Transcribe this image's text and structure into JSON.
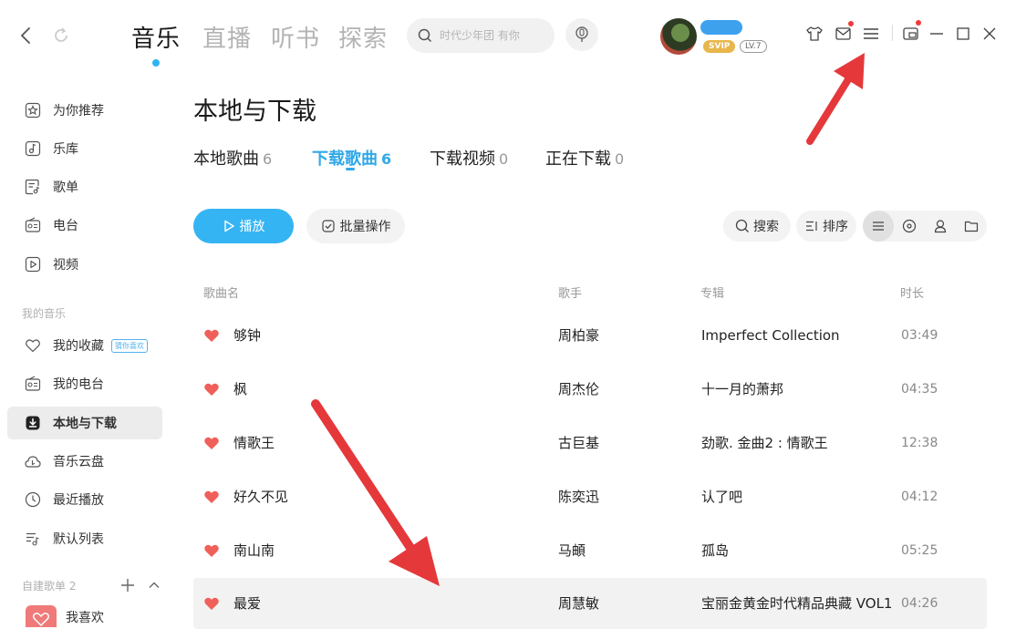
{
  "nav": {
    "main_tabs": [
      "音乐",
      "直播",
      "听书",
      "探索"
    ],
    "active_tab": "音乐"
  },
  "search": {
    "placeholder": "时代少年团 有你"
  },
  "user": {
    "vip_badge": "SVIP",
    "level_badge": "LV.7"
  },
  "sidebar": {
    "items": [
      {
        "label": "为你推荐",
        "icon": "star-icon"
      },
      {
        "label": "乐库",
        "icon": "music-note-icon"
      },
      {
        "label": "歌单",
        "icon": "playlist-icon"
      },
      {
        "label": "电台",
        "icon": "radio-icon"
      },
      {
        "label": "视频",
        "icon": "video-icon"
      }
    ],
    "my_music_heading": "我的音乐",
    "my_music": [
      {
        "label": "我的收藏",
        "icon": "heart-outline-icon",
        "badge": "猜你喜欢"
      },
      {
        "label": "我的电台",
        "icon": "radio-icon"
      },
      {
        "label": "本地与下载",
        "icon": "download-icon"
      },
      {
        "label": "音乐云盘",
        "icon": "cloud-icon"
      },
      {
        "label": "最近播放",
        "icon": "clock-icon"
      },
      {
        "label": "默认列表",
        "icon": "list-music-icon"
      }
    ],
    "created_heading": "自建歌单",
    "created_count": "2",
    "created_items": [
      {
        "label": "我喜欢"
      }
    ]
  },
  "page": {
    "title": "本地与下载",
    "subtabs": [
      {
        "label": "本地歌曲",
        "count": "6"
      },
      {
        "label": "下载歌曲",
        "count": "6",
        "active": true
      },
      {
        "label": "下载视频",
        "count": "0"
      },
      {
        "label": "正在下载",
        "count": "0"
      }
    ]
  },
  "toolbar": {
    "play": "播放",
    "batch": "批量操作",
    "search": "搜索",
    "sort": "排序"
  },
  "table": {
    "headers": {
      "name": "歌曲名",
      "artist": "歌手",
      "album": "专辑",
      "duration": "时长"
    },
    "rows": [
      {
        "name": "够钟",
        "artist": "周柏豪",
        "album": "Imperfect Collection",
        "duration": "03:49"
      },
      {
        "name": "枫",
        "artist": "周杰伦",
        "album": "十一月的萧邦",
        "duration": "04:35"
      },
      {
        "name": "情歌王",
        "artist": "古巨基",
        "album": "劲歌. 金曲2 : 情歌王",
        "duration": "12:38"
      },
      {
        "name": "好久不见",
        "artist": "陈奕迅",
        "album": "认了吧",
        "duration": "04:12"
      },
      {
        "name": "南山南",
        "artist": "马頔",
        "album": "孤岛",
        "duration": "05:25"
      },
      {
        "name": "最爱",
        "artist": "周慧敏",
        "album": "宝丽金黄金时代精品典藏 VOL1",
        "duration": "04:26"
      }
    ]
  },
  "colors": {
    "accent": "#35b4f4",
    "heart": "#f0605a",
    "annotation": "#e5383b"
  }
}
